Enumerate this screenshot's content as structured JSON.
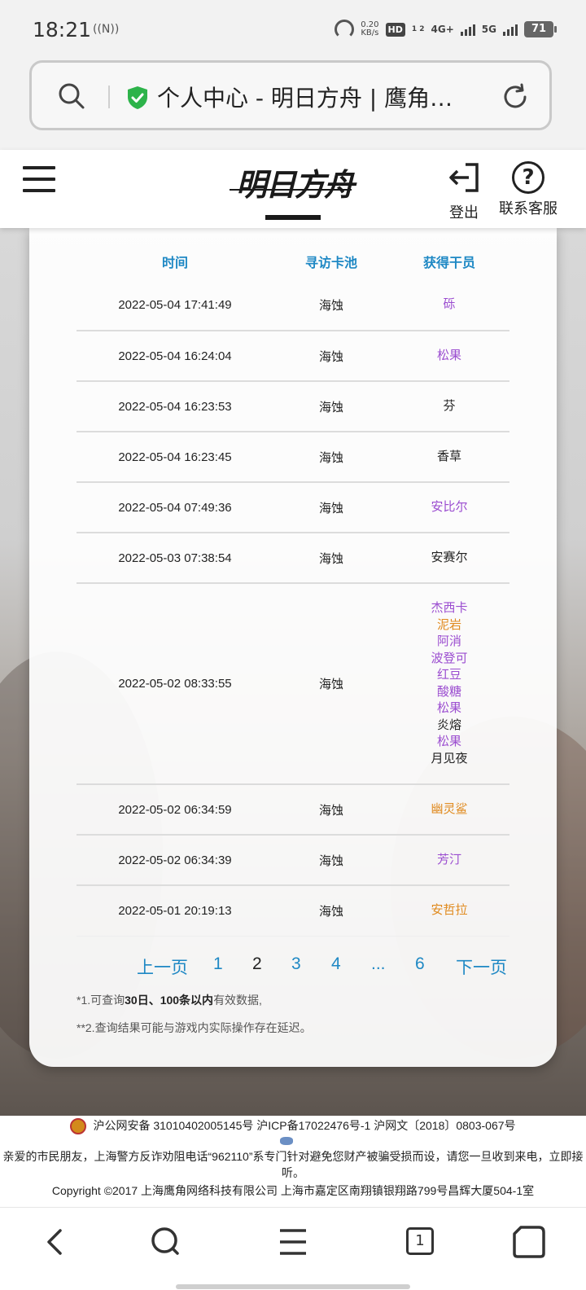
{
  "status_bar": {
    "time": "18:21",
    "nfc": "((N))",
    "net_speed_value": "0.20",
    "net_speed_unit": "KB/s",
    "hd_label": "HD",
    "hd_sub": "1 2",
    "sig1": "4G+",
    "sig2": "5G",
    "battery": "71"
  },
  "address_bar": {
    "title": "个人中心 - 明日方舟 | 鹰角…"
  },
  "site_header": {
    "logo_text": "明日方舟",
    "logout_label": "登出",
    "help_label": "联系客服",
    "help_glyph": "?"
  },
  "table": {
    "headers": [
      "时间",
      "寻访卡池",
      "获得干员"
    ],
    "rows": [
      {
        "time": "2022-05-04 17:41:49",
        "pool": "海蚀",
        "operators": [
          {
            "name": "砾",
            "rarity": "r4"
          }
        ]
      },
      {
        "time": "2022-05-04 16:24:04",
        "pool": "海蚀",
        "operators": [
          {
            "name": "松果",
            "rarity": "r4"
          }
        ]
      },
      {
        "time": "2022-05-04 16:23:53",
        "pool": "海蚀",
        "operators": [
          {
            "name": "芬",
            "rarity": "r3"
          }
        ]
      },
      {
        "time": "2022-05-04 16:23:45",
        "pool": "海蚀",
        "operators": [
          {
            "name": "香草",
            "rarity": "r3"
          }
        ]
      },
      {
        "time": "2022-05-04 07:49:36",
        "pool": "海蚀",
        "operators": [
          {
            "name": "安比尔",
            "rarity": "r4"
          }
        ]
      },
      {
        "time": "2022-05-03 07:38:54",
        "pool": "海蚀",
        "operators": [
          {
            "name": "安赛尔",
            "rarity": "r3"
          }
        ]
      },
      {
        "time": "2022-05-02 08:33:55",
        "pool": "海蚀",
        "operators": [
          {
            "name": "杰西卡",
            "rarity": "r4"
          },
          {
            "name": "泥岩",
            "rarity": "r5"
          },
          {
            "name": "阿消",
            "rarity": "r4"
          },
          {
            "name": "波登可",
            "rarity": "r4"
          },
          {
            "name": "红豆",
            "rarity": "r4"
          },
          {
            "name": "酸糖",
            "rarity": "r4"
          },
          {
            "name": "松果",
            "rarity": "r4"
          },
          {
            "name": "炎熔",
            "rarity": "r3"
          },
          {
            "name": "松果",
            "rarity": "r4"
          },
          {
            "name": "月见夜",
            "rarity": "r3"
          }
        ]
      },
      {
        "time": "2022-05-02 06:34:59",
        "pool": "海蚀",
        "operators": [
          {
            "name": "幽灵鲨",
            "rarity": "r5"
          }
        ]
      },
      {
        "time": "2022-05-02 06:34:39",
        "pool": "海蚀",
        "operators": [
          {
            "name": "芳汀",
            "rarity": "r4"
          }
        ]
      },
      {
        "time": "2022-05-01 20:19:13",
        "pool": "海蚀",
        "operators": [
          {
            "name": "安哲拉",
            "rarity": "r5"
          }
        ]
      }
    ]
  },
  "pagination": {
    "prev": "上一页",
    "pages": [
      "1",
      "2",
      "3",
      "4",
      "...",
      "6"
    ],
    "current": "2",
    "next": "下一页"
  },
  "notes": {
    "note1_prefix": "*1.可查询",
    "note1_bold": "30日、100条以内",
    "note1_suffix": "有效数据,",
    "note2": "**2.查询结果可能与游戏内实际操作存在延迟。"
  },
  "footer": {
    "line1": "沪公网安备 31010402005145号  沪ICP备17022476号-1  沪网文〔2018〕0803-067号",
    "line2": "亲爱的市民朋友，上海警方反诈劝阻电话“962110”系专门针对避免您财产被骗受损而设，请您一旦收到来电，立即接听。",
    "line3": "Copyright ©2017 上海鹰角网络科技有限公司  上海市嘉定区南翔镇银翔路799号昌辉大厦504-1室"
  },
  "bottom_nav": {
    "tab_count": "1",
    "items": [
      "back-icon",
      "search-icon",
      "menu-icon",
      "tabs-icon",
      "home-icon"
    ]
  },
  "colors": {
    "accent_blue": "#1e88c4",
    "rarity_4": "#9b4dd0",
    "rarity_5": "#e08a1e",
    "rarity_3": "#222222"
  }
}
